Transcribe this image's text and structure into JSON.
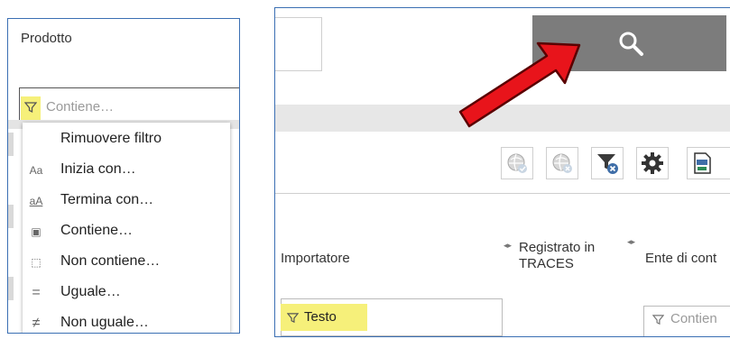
{
  "left_panel": {
    "title": "Prodotto",
    "filter_placeholder": "Contiene…",
    "menu": [
      {
        "icon": "none",
        "label": "Rimuovere filtro"
      },
      {
        "icon": "starts-with-icon",
        "glyph": "Aa",
        "label": "Inizia con…"
      },
      {
        "icon": "ends-with-icon",
        "glyph": "aA",
        "label": "Termina con…"
      },
      {
        "icon": "contains-icon",
        "glyph": "▣",
        "label": "Contiene…"
      },
      {
        "icon": "not-contains-icon",
        "glyph": "⬚",
        "label": "Non contiene…"
      },
      {
        "icon": "equals-icon",
        "glyph": "=",
        "label": "Uguale…"
      },
      {
        "icon": "not-equals-icon",
        "glyph": "≠",
        "label": "Non uguale…"
      }
    ]
  },
  "right_panel": {
    "columns": {
      "importatore": "Importatore",
      "registrato_line1": "Registrato in",
      "registrato_line2": "TRACES",
      "ente": "Ente di cont"
    },
    "filters": {
      "testo": "Testo",
      "ente_placeholder": "Contien"
    },
    "toolbar": [
      "globe-check-icon",
      "globe-x-icon",
      "clear-filter-icon",
      "settings-gear-icon",
      "export-xls-icon"
    ]
  },
  "colors": {
    "highlight": "#f6f07a",
    "arrow": "#e8141b",
    "panel_border": "#3b6fb3",
    "search_button": "#7c7c7c"
  }
}
